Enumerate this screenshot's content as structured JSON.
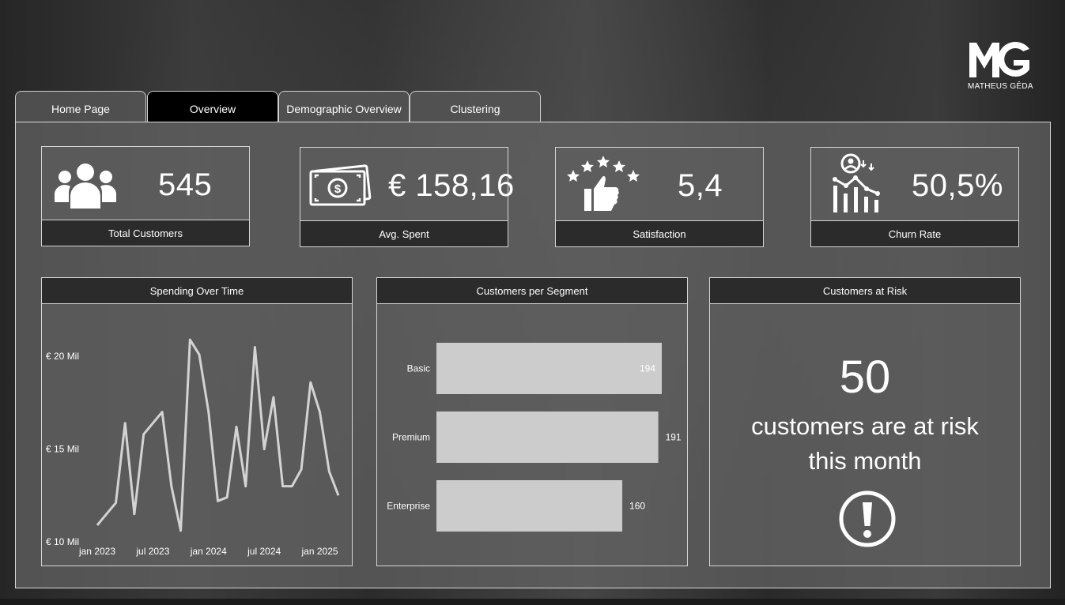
{
  "brand": {
    "name": "MATHEUS GÊDA"
  },
  "tabs": [
    {
      "label": "Home Page",
      "active": false
    },
    {
      "label": "Overview",
      "active": true
    },
    {
      "label": "Demographic Overview",
      "active": false
    },
    {
      "label": "Clustering",
      "active": false
    }
  ],
  "kpis": {
    "customers": {
      "value": "545",
      "label": "Total Customers",
      "icon": "users-icon"
    },
    "spent": {
      "value": "€ 158,16",
      "label": "Avg. Spent",
      "icon": "money-icon"
    },
    "satisfaction": {
      "value": "5,4",
      "label": "Satisfaction",
      "icon": "thumbs-up-stars-icon"
    },
    "churn": {
      "value": "50,5%",
      "label": "Churn Rate",
      "icon": "churn-chart-icon"
    }
  },
  "risk": {
    "title": "Customers at Risk",
    "value": "50",
    "line1": "customers are at risk",
    "line2": "this month",
    "icon": "alert-icon"
  },
  "chart_data": [
    {
      "type": "line",
      "title": "Spending Over Time",
      "y_tick_labels": [
        "€ 10 Mil",
        "€ 15 Mil",
        "€ 20 Mil"
      ],
      "y_ticks": [
        10,
        15,
        20
      ],
      "x_tick_labels": [
        "jan 2023",
        "jul 2023",
        "jan 2024",
        "jul 2024",
        "jan 2025"
      ],
      "x_tick_index": [
        0,
        6,
        12,
        18,
        24
      ],
      "ylim": [
        10,
        21.5
      ],
      "grid": false,
      "color": "#d3d3d3",
      "values": [
        10.9,
        11.5,
        12.1,
        16.4,
        11.5,
        15.8,
        16.4,
        17.0,
        13.0,
        10.6,
        20.9,
        20.1,
        17.0,
        12.2,
        12.4,
        16.2,
        13.0,
        20.5,
        15.0,
        17.8,
        13.0,
        13.0,
        13.9,
        18.6,
        17.0,
        13.8,
        12.5
      ]
    },
    {
      "type": "bar",
      "orientation": "horizontal",
      "title": "Customers per Segment",
      "categories": [
        "Basic",
        "Premium",
        "Enterprise"
      ],
      "values": [
        194,
        191,
        160
      ],
      "xlim": [
        0,
        194
      ],
      "color": "#cccccc"
    }
  ]
}
